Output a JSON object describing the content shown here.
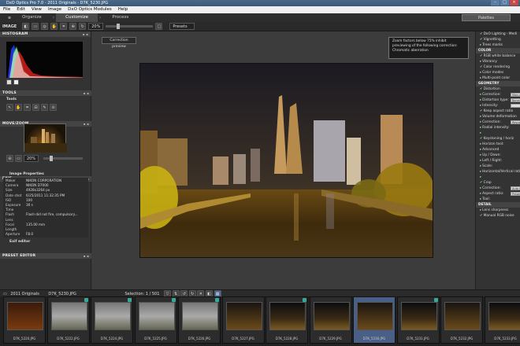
{
  "window": {
    "title": "DxO Optics Pro 7.0 - 2011 Originals - D7K_5230.JPG"
  },
  "menu": [
    "File",
    "Edit",
    "View",
    "Image",
    "DxO Optics Modules",
    "Help"
  ],
  "tabs": [
    "Organize",
    "Customize",
    "Process"
  ],
  "palettes_label": "Palettes",
  "toolbar": {
    "image_label": "IMAGE",
    "zoom_value": "20%",
    "presets_label": "Presets"
  },
  "left": {
    "histogram_title": "HISTOGRAM",
    "tools_title": "TOOLS",
    "tools_label": "Tools",
    "movezoom_title": "MOVE/ZOOM",
    "nav_zoom": "20%",
    "exif_title": "EXIF",
    "image_properties": "Image Properties",
    "exif": [
      {
        "k": "Maker",
        "v": "NIKON CORPORATION"
      },
      {
        "k": "Camera",
        "v": "NIKON D7000"
      },
      {
        "k": "Size",
        "v": "4928x3264 px"
      },
      {
        "k": "Date shot",
        "v": "6/25/2011 11:32:35 PM"
      },
      {
        "k": "ISO",
        "v": "100"
      },
      {
        "k": "Exposure Time",
        "v": "30 s"
      },
      {
        "k": "Flash",
        "v": "Flash did not fire, compulsory..."
      },
      {
        "k": "Lens",
        "v": ""
      },
      {
        "k": "Focal Length",
        "v": "135.00 mm"
      },
      {
        "k": "Aperture",
        "v": "F8.0"
      }
    ],
    "exif_editor": "Exif editor",
    "preset_editor_title": "PRESET EDITOR"
  },
  "center": {
    "correction_preview": "Correction preview",
    "zoom_note": "Zoom factors below 75% inhibit previewing of the following correction: Chromatic aberration"
  },
  "right": [
    {
      "t": "row",
      "text": "DxO Lighting - Medi",
      "check": true
    },
    {
      "t": "row",
      "text": "Vignetting",
      "check": true
    },
    {
      "t": "row",
      "text": "Trees marks",
      "check": false
    },
    {
      "t": "h",
      "text": "COLOR"
    },
    {
      "t": "row",
      "text": "RGB white balance",
      "check": true
    },
    {
      "t": "row",
      "text": "Vibrancy",
      "check": false
    },
    {
      "t": "row",
      "text": "Color rendering",
      "check": true
    },
    {
      "t": "row",
      "text": "Color modes",
      "check": false
    },
    {
      "t": "row",
      "text": "Multi-point color",
      "check": false
    },
    {
      "t": "h",
      "text": "GEOMETRY"
    },
    {
      "t": "row",
      "text": "Distortion",
      "check": true
    },
    {
      "t": "row",
      "text": "Correction:",
      "input": "Manual"
    },
    {
      "t": "row",
      "text": "Distortion type:",
      "input": "Barrel"
    },
    {
      "t": "row",
      "text": "Intensity:",
      "input": ""
    },
    {
      "t": "row",
      "text": "Keep aspect ratio",
      "check": true
    },
    {
      "t": "row",
      "text": "Volume deformation",
      "check": false
    },
    {
      "t": "row",
      "text": "Correction:",
      "input": "Resize sp"
    },
    {
      "t": "row",
      "text": "Radial intensity:",
      "check": false
    },
    {
      "t": "row",
      "text": "",
      "check": false
    },
    {
      "t": "row",
      "text": "Keystoning / horiz",
      "check": true
    },
    {
      "t": "row",
      "text": "Horizon tool:",
      "check": false
    },
    {
      "t": "row",
      "text": "Advanced",
      "check": false
    },
    {
      "t": "row",
      "text": "Up / Down:",
      "check": false
    },
    {
      "t": "row",
      "text": "Left / Right:",
      "check": false
    },
    {
      "t": "row",
      "text": "Scale:",
      "check": false
    },
    {
      "t": "row",
      "text": "Horizontal/Vertical ratio",
      "check": false
    },
    {
      "t": "row",
      "text": "",
      "check": false
    },
    {
      "t": "row",
      "text": "Crop",
      "check": true
    },
    {
      "t": "row",
      "text": "Correction:",
      "input": "Auto based"
    },
    {
      "t": "row",
      "text": "Aspect ratio:",
      "input": "Preserve asp"
    },
    {
      "t": "row",
      "text": "Tool:",
      "check": false
    },
    {
      "t": "h",
      "text": "DETAIL"
    },
    {
      "t": "row",
      "text": "Lens sharpness",
      "check": false
    },
    {
      "t": "row",
      "text": "Manual RGB noise",
      "check": true
    }
  ],
  "filmstrip": {
    "folder": "2011 Originals",
    "file": "D7K_5230.JPG",
    "selection": "Selection: 1 / 501",
    "thumbs": [
      {
        "label": "D7K_5220.JPG",
        "style": "dark",
        "star": false,
        "sel": false
      },
      {
        "label": "D7K_5222.JPG",
        "style": "gray",
        "star": true,
        "sel": false
      },
      {
        "label": "D7K_5224.JPG",
        "style": "gray",
        "star": true,
        "sel": false
      },
      {
        "label": "D7K_5225.JPG",
        "style": "gray",
        "star": true,
        "sel": false
      },
      {
        "label": "D7K_5226.JPG",
        "style": "gray",
        "star": true,
        "sel": false
      },
      {
        "label": "D7K_5227.JPG",
        "style": "night",
        "star": false,
        "sel": false
      },
      {
        "label": "D7K_5228.JPG",
        "style": "night2",
        "star": true,
        "sel": false
      },
      {
        "label": "D7K_5229.JPG",
        "style": "night2",
        "star": false,
        "sel": false
      },
      {
        "label": "D7K_5230.JPG",
        "style": "night",
        "star": false,
        "sel": true
      },
      {
        "label": "D7K_5231.JPG",
        "style": "night2",
        "star": true,
        "sel": false
      },
      {
        "label": "D7K_5232.JPG",
        "style": "night",
        "star": false,
        "sel": false
      },
      {
        "label": "D7K_5233.JPG",
        "style": "night2",
        "star": false,
        "sel": false
      }
    ]
  }
}
